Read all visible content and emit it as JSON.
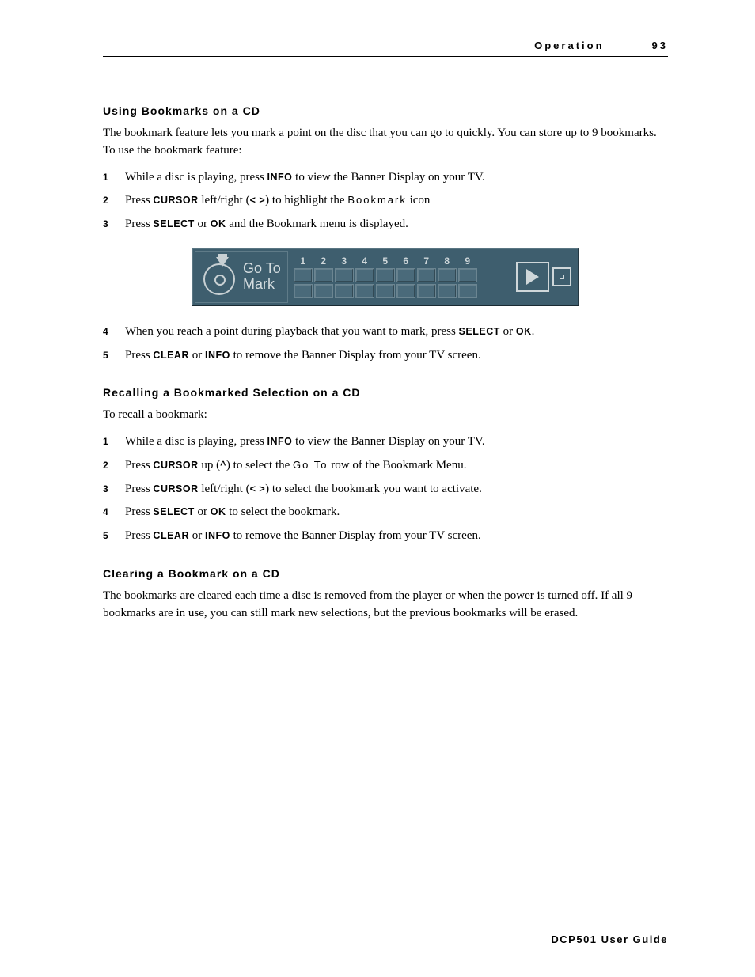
{
  "header": {
    "title": "Operation",
    "page_number": "93"
  },
  "section1": {
    "heading": "Using Bookmarks on a CD",
    "intro": "The bookmark feature lets you mark a point on the disc that you can go to quickly. You can store up to 9 bookmarks. To use the bookmark feature:",
    "steps": [
      {
        "n": "1",
        "pre": "While a disc is playing, press ",
        "kw1": "INFO",
        "post1": " to view the Banner Display on your TV."
      },
      {
        "n": "2",
        "pre": "Press ",
        "kw1": "CURSOR",
        "post1": " left/right (",
        "kw2": "< >",
        "post2": ") to highlight the ",
        "sp": "Bookmark",
        "post3": " icon"
      },
      {
        "n": "3",
        "pre": "Press ",
        "kw1": "SELECT",
        "mid": " or ",
        "kw2": "OK",
        "post2": " and the Bookmark menu is displayed."
      },
      {
        "n": "4",
        "pre": "When you reach a point during playback that you want to mark, press ",
        "kw1": "SELECT",
        "mid": " or ",
        "kw2": "OK",
        "post2": "."
      },
      {
        "n": "5",
        "pre": "Press ",
        "kw1": "CLEAR",
        "mid": " or ",
        "kw2": "INFO",
        "post2": " to remove the Banner Display from your TV screen."
      }
    ]
  },
  "figure": {
    "left_line1": "Go To",
    "left_line2": "Mark",
    "numbers": [
      "1",
      "2",
      "3",
      "4",
      "5",
      "6",
      "7",
      "8",
      "9"
    ]
  },
  "section2": {
    "heading": "Recalling a Bookmarked Selection on a CD",
    "intro": "To recall a bookmark:",
    "steps": [
      {
        "n": "1",
        "pre": "While a disc is playing, press ",
        "kw1": "INFO",
        "post1": " to view the Banner Display on your TV."
      },
      {
        "n": "2",
        "pre": "Press ",
        "kw1": "CURSOR",
        "post1": " up (",
        "kw2": "^",
        "post2": ") to select the ",
        "sp": "Go To",
        "post3": " row of the Bookmark Menu."
      },
      {
        "n": "3",
        "pre": "Press ",
        "kw1": "CURSOR",
        "post1": " left/right (",
        "kw2": "< >",
        "post2": ") to select the bookmark you want to activate."
      },
      {
        "n": "4",
        "pre": "Press ",
        "kw1": "SELECT",
        "mid": " or ",
        "kw2": "OK",
        "post2": " to select the bookmark."
      },
      {
        "n": "5",
        "pre": "Press ",
        "kw1": "CLEAR",
        "mid": " or ",
        "kw2": "INFO",
        "post2": " to remove the Banner Display from your TV screen."
      }
    ]
  },
  "section3": {
    "heading": "Clearing a Bookmark on a CD",
    "intro": "The bookmarks are cleared each time a disc is removed from the player or when the power is turned off. If all 9 bookmarks are in use, you can still mark new selections, but the previous bookmarks will be erased."
  },
  "footer": "DCP501 User Guide"
}
